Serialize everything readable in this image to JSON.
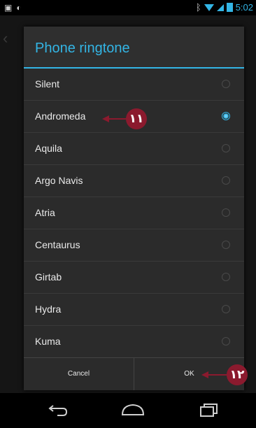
{
  "status": {
    "time": "5:02"
  },
  "dialog": {
    "title": "Phone ringtone",
    "options": [
      {
        "label": "Silent",
        "selected": false
      },
      {
        "label": "Andromeda",
        "selected": true
      },
      {
        "label": "Aquila",
        "selected": false
      },
      {
        "label": "Argo Navis",
        "selected": false
      },
      {
        "label": "Atria",
        "selected": false
      },
      {
        "label": "Centaurus",
        "selected": false
      },
      {
        "label": "Girtab",
        "selected": false
      },
      {
        "label": "Hydra",
        "selected": false
      },
      {
        "label": "Kuma",
        "selected": false
      }
    ],
    "cancel_label": "Cancel",
    "ok_label": "OK"
  },
  "callouts": {
    "step_11": "١١",
    "step_12": "١٢"
  },
  "colors": {
    "accent": "#33b5e5",
    "callout": "#8b1a2e"
  },
  "icons": {
    "back": "back-icon",
    "home": "home-icon",
    "recents": "recents-icon"
  }
}
